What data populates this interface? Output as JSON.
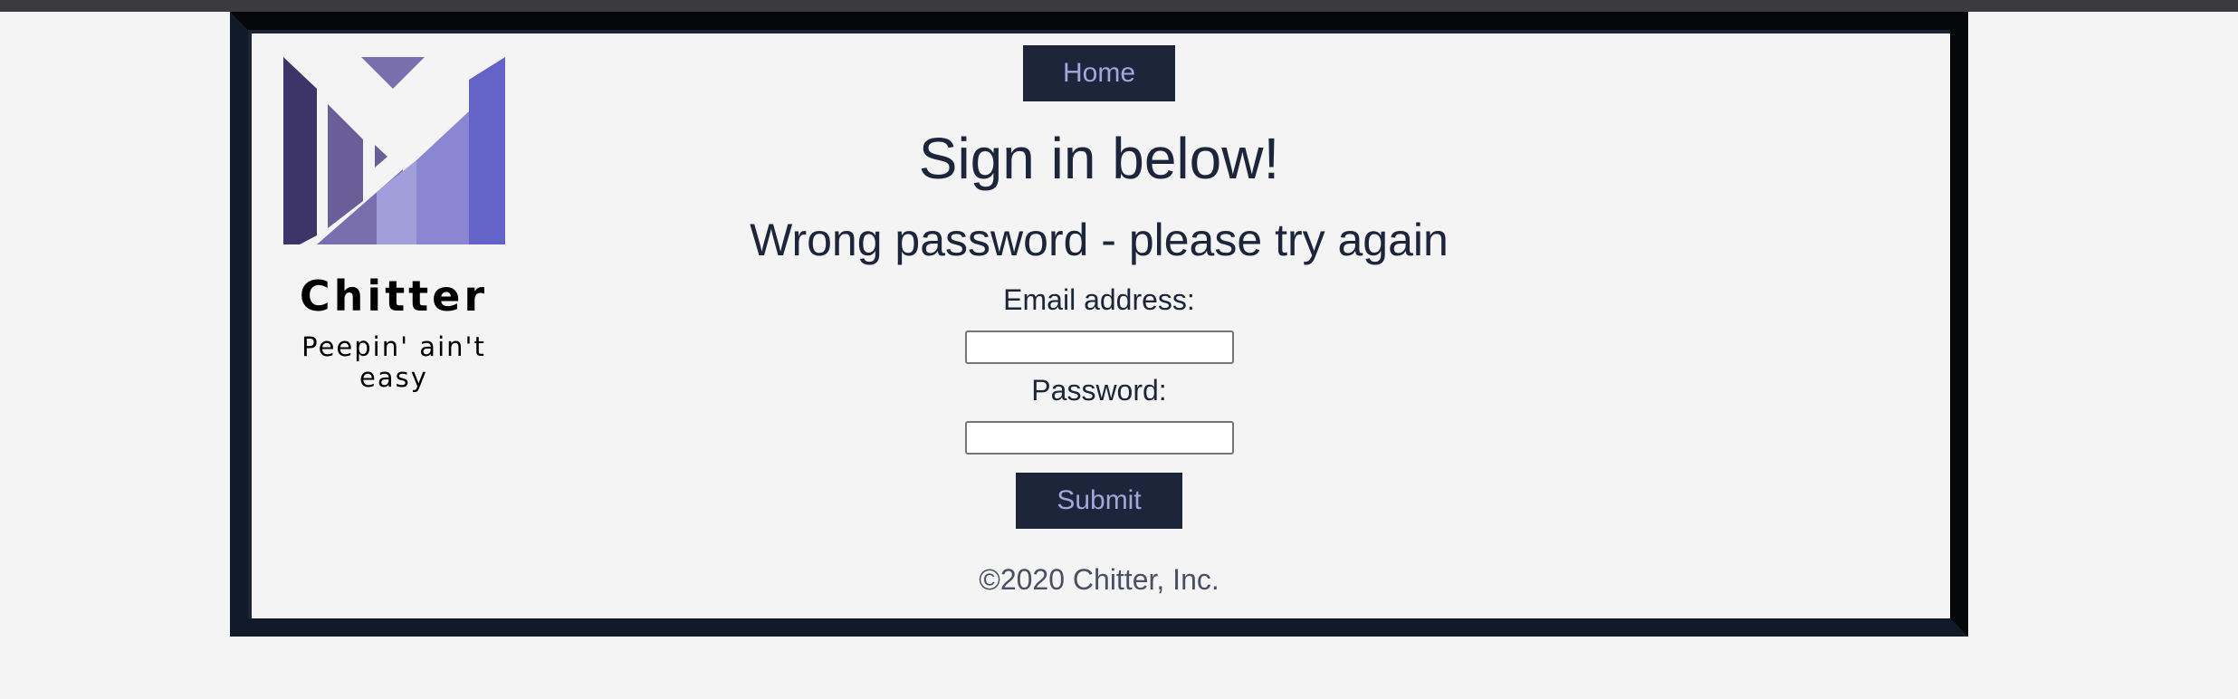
{
  "brand": {
    "name": "Chitter",
    "tagline": "Peepin' ain't easy"
  },
  "nav": {
    "home_label": "Home"
  },
  "page": {
    "heading": "Sign in below!",
    "error_message": "Wrong password - please try again"
  },
  "form": {
    "email_label": "Email address:",
    "email_value": "",
    "password_label": "Password:",
    "password_value": "",
    "submit_label": "Submit"
  },
  "footer": {
    "copyright": "©2020 Chitter, Inc."
  },
  "colors": {
    "navy": "#1d253a",
    "button_text": "#a0a8dc",
    "logo_purple_dark": "#3d3468",
    "logo_purple_light": "#a09fdc",
    "logo_blue": "#6464c8"
  }
}
